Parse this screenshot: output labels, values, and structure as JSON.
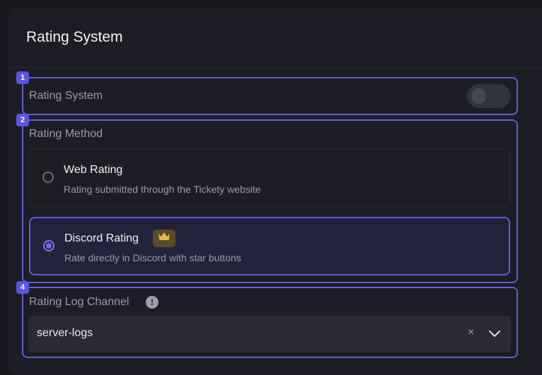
{
  "card": {
    "title": "Rating System"
  },
  "sections": {
    "toggle": {
      "badge": "1",
      "label": "Rating System",
      "enabled": false
    },
    "method": {
      "badge": "2",
      "label": "Rating Method",
      "options": [
        {
          "title": "Web Rating",
          "description": "Rating submitted through the Tickety website",
          "selected": false
        },
        {
          "title": "Discord Rating",
          "description": "Rate directly in Discord with star buttons",
          "selected": true,
          "premium_icon": "crown-icon"
        }
      ]
    },
    "log_channel": {
      "badge": "4",
      "label": "Rating Log Channel",
      "info_icon": "!",
      "value": "server-logs",
      "clear_icon": "×"
    }
  },
  "colors": {
    "accent": "#5f5fd6",
    "badge": "#5a55e0",
    "crown": "#e7b65a"
  }
}
